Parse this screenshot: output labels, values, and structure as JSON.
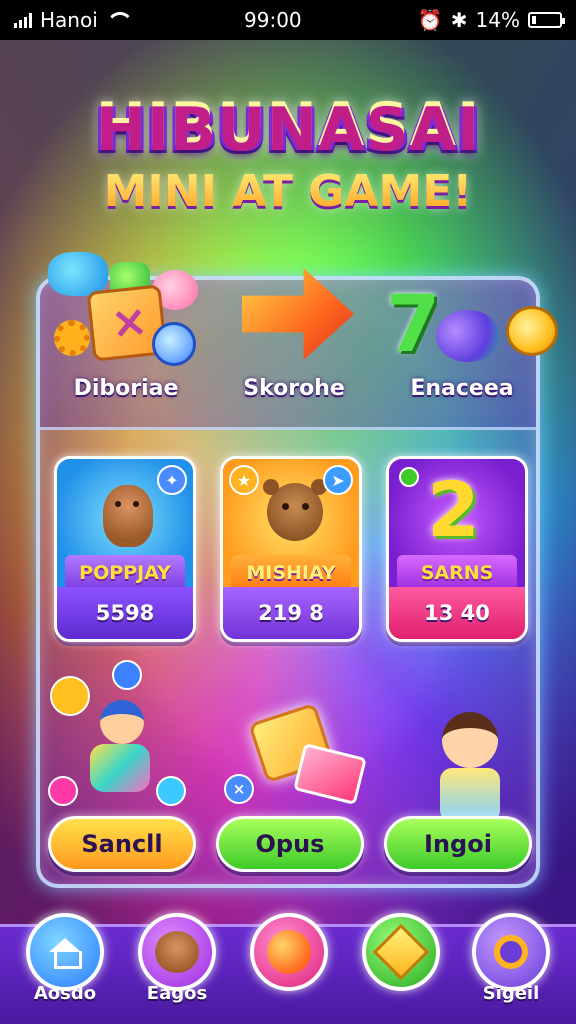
{
  "status_bar": {
    "carrier": "Hanoi",
    "time": "99:00",
    "battery": "14%",
    "icons": [
      "signal-icon",
      "wifi-icon",
      "alarm-icon",
      "bluetooth-icon",
      "battery-icon"
    ]
  },
  "header": {
    "title_line1": "HIBUNASAI",
    "title_line2": "MINI AT GAME!"
  },
  "top_row": {
    "items": [
      {
        "label": "Diboriae",
        "icon": "dice-cube-icon"
      },
      {
        "label": "Skorohe",
        "icon": "arrow-right-icon"
      },
      {
        "label": "Enaceea",
        "icon": "lucky-seven-icon"
      }
    ]
  },
  "cards": [
    {
      "banner": "POPPJAY",
      "score": "5598",
      "mascot": "otter-mascot-icon",
      "badge": "star-badge-icon",
      "colors": {
        "art": "#2190e8",
        "footer": "#5e2bd0"
      }
    },
    {
      "banner": "MISHIAY",
      "score": "219 8",
      "mascot": "bear-mascot-icon",
      "badge": "send-badge-icon",
      "colors": {
        "art": "#ff9c1e",
        "footer": "#7332d6"
      }
    },
    {
      "banner": "SARNS",
      "score": "13 40",
      "mascot": "number-two-icon",
      "badge": "orb-badge-icon",
      "big_glyph": "2",
      "colors": {
        "art": "#7a1fd0",
        "footer": "#e01f6e"
      }
    }
  ],
  "buttons": [
    {
      "label": "Sancll",
      "color": "#ff9a1e"
    },
    {
      "label": "Opus",
      "color": "#3ecb2a"
    },
    {
      "label": "Ingoi",
      "color": "#3ecb2a"
    }
  ],
  "bottom_nav": {
    "items": [
      {
        "label": "Aosdo",
        "icon": "home-icon",
        "color": "#2a9cff"
      },
      {
        "label": "Eagos",
        "icon": "bear-face-icon",
        "color": "#b04ae0"
      },
      {
        "label": "",
        "icon": "ball-icon",
        "color": "#ff3aa8"
      },
      {
        "label": "",
        "icon": "gem-icon",
        "color": "#3ecb2a"
      },
      {
        "label": "Sigeil",
        "icon": "profile-icon",
        "color": "#8a4cff"
      }
    ]
  }
}
